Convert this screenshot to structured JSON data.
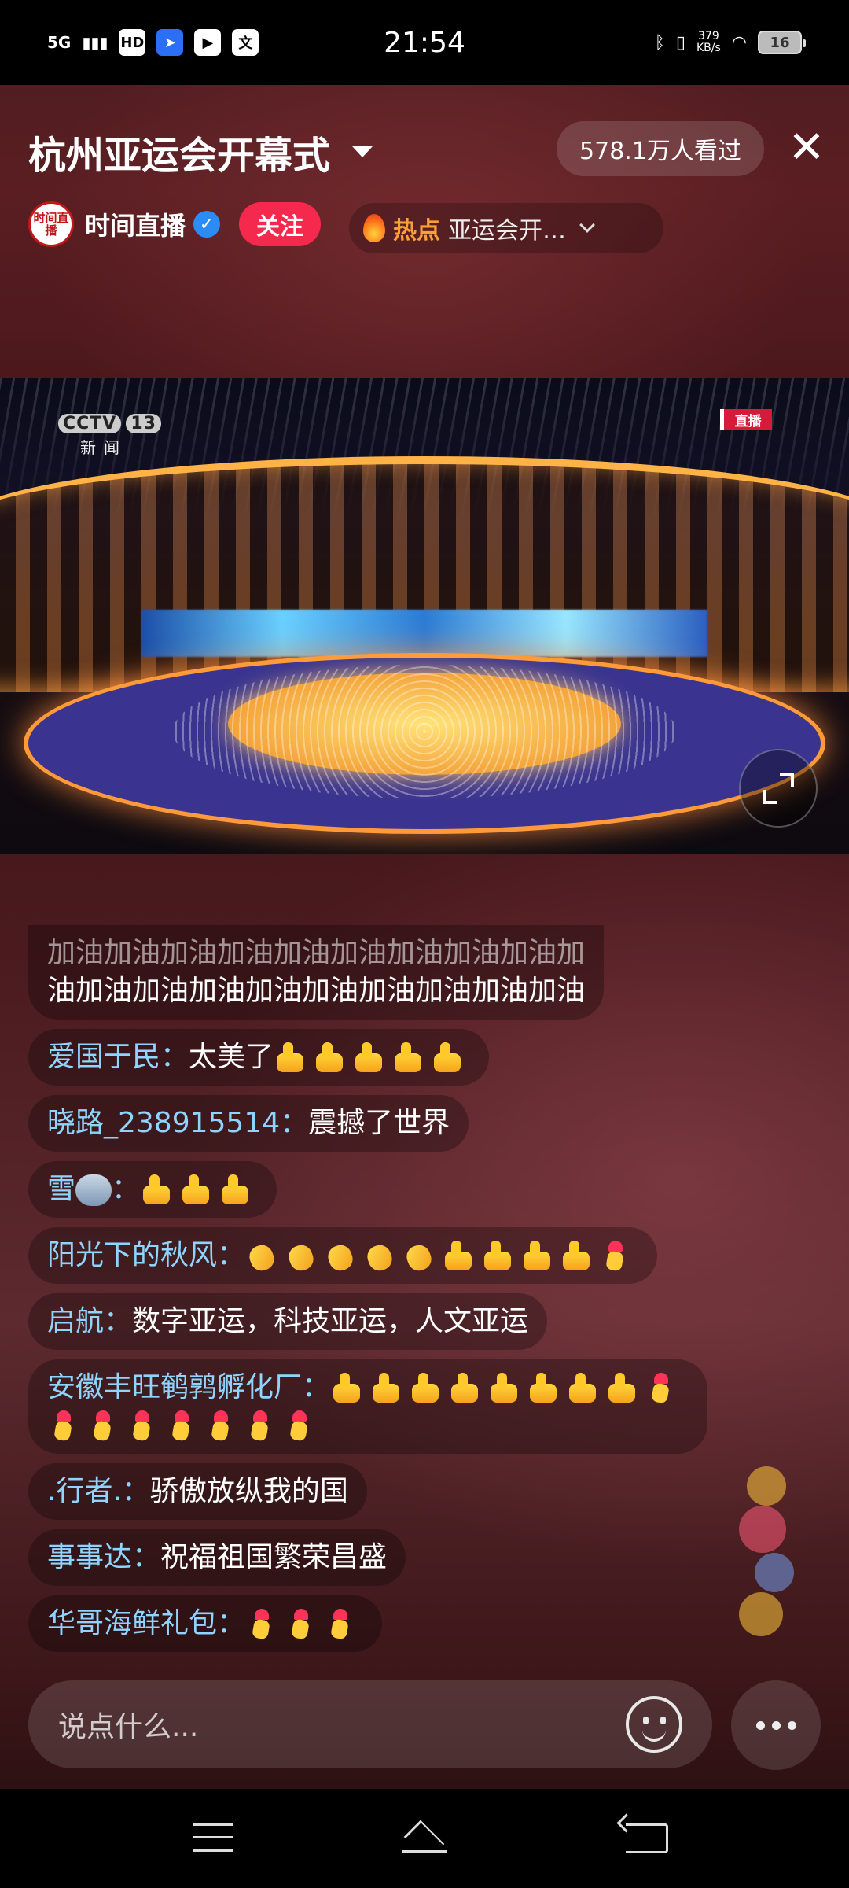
{
  "status_bar": {
    "network": "5G",
    "hd": "HD",
    "time": "21:54",
    "speed_value": "379",
    "speed_unit": "KB/s",
    "battery": "16"
  },
  "header": {
    "title": "杭州亚运会开幕式",
    "viewers": "578.1万人看过",
    "close_glyph": "✕"
  },
  "author": {
    "avatar_text": "时间直播",
    "name": "时间直播",
    "verified_glyph": "✓",
    "follow_label": "关注"
  },
  "hot": {
    "label": "热点",
    "topic": "亚运会开…"
  },
  "video": {
    "channel_logo": "CCTV",
    "channel_number": "13",
    "channel_sub": "新闻",
    "live_badge": "直播"
  },
  "comments": [
    {
      "user": "",
      "text_faded": "加油加油加油加油加油加油加油加油加油加",
      "text": "油加油加油加油加油加油加油加油加油加油"
    },
    {
      "user": "爱国于民：",
      "text": "太美了",
      "emojis": [
        "thumb",
        "thumb",
        "thumb",
        "thumb",
        "thumb"
      ]
    },
    {
      "user": "晓路_238915514：",
      "text": "震撼了世界",
      "emojis": []
    },
    {
      "user": "雪",
      "user_suffix": "：",
      "text": "",
      "emojis": [
        "thumb",
        "thumb",
        "thumb"
      ]
    },
    {
      "user": "阳光下的秋风：",
      "text": "",
      "emojis": [
        "clap",
        "clap",
        "clap",
        "clap",
        "clap",
        "thumb",
        "thumb",
        "thumb",
        "thumb",
        "heart"
      ]
    },
    {
      "user": "启航：",
      "text": "数字亚运，科技亚运，人文亚运",
      "emojis": []
    },
    {
      "user": "安徽丰旺鹌鹑孵化厂：",
      "text": "",
      "emojis": [
        "thumb",
        "thumb",
        "thumb",
        "thumb",
        "thumb",
        "thumb",
        "thumb",
        "thumb",
        "heart",
        "heart",
        "heart",
        "heart",
        "heart",
        "heart",
        "heart",
        "heart"
      ]
    },
    {
      "user": ".行者.：",
      "text": "骄傲放纵我的国",
      "emojis": []
    },
    {
      "user": "事事达：",
      "text": "祝福祖国繁荣昌盛",
      "emojis": []
    },
    {
      "user": "华哥海鲜礼包：",
      "text": "",
      "emojis": [
        "heart",
        "heart",
        "heart"
      ]
    }
  ],
  "input": {
    "placeholder": "说点什么..."
  },
  "colors": {
    "username": "#8fd4ff",
    "follow": "#f5284e",
    "hot_label": "#ff9d3a",
    "verified": "#2b8cf7"
  }
}
